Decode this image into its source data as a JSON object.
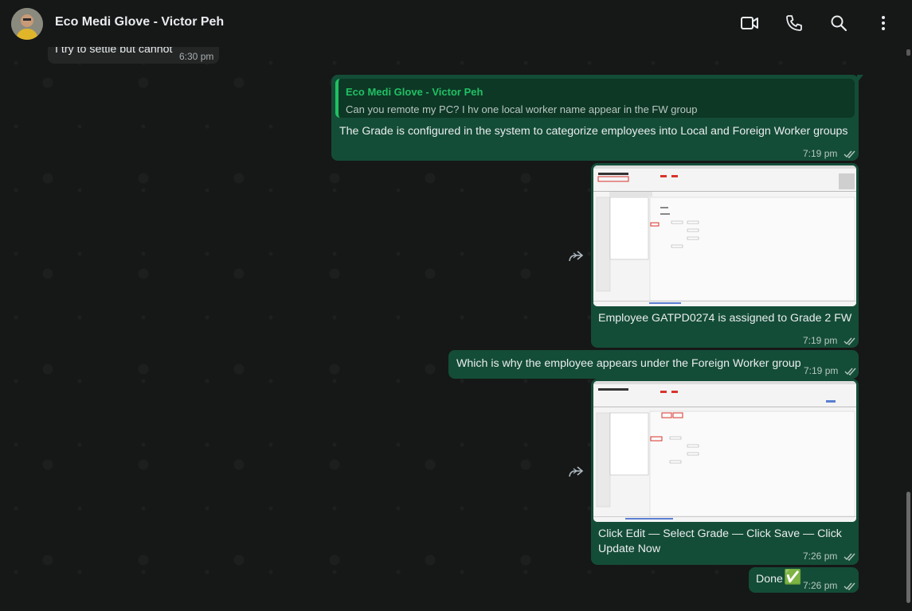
{
  "header": {
    "contact_name": "Eco Medi Glove - Victor Peh",
    "icons": [
      "video-call-icon",
      "voice-call-icon",
      "search-icon",
      "menu-icon"
    ]
  },
  "messages": {
    "m0": {
      "text": "I try to settle but cannot",
      "time": "6:30 pm"
    },
    "m1": {
      "quote_name": "Eco Medi Glove - Victor Peh",
      "quote_text": "Can you remote my PC? I hv one local worker name appear in the FW group",
      "text": "The Grade is configured in the system to categorize employees into Local and Foreign Worker groups",
      "time": "7:19 pm"
    },
    "m2": {
      "caption": "Employee GATPD0274 is assigned to Grade 2 FW",
      "time": "7:19 pm"
    },
    "m3": {
      "text": "Which is why the employee appears under the Foreign Worker group",
      "time": "7:19 pm"
    },
    "m4": {
      "caption_line1": "Click Edit — Select Grade — Click Save — Click",
      "caption_line2": "Update Now",
      "time": "7:26 pm"
    },
    "m5": {
      "text": "Done",
      "emoji": "✅",
      "time": "7:26 pm"
    }
  },
  "colors": {
    "outgoing_bubble": "#144d37",
    "incoming_bubble": "#242626",
    "quote_accent": "#21c063",
    "read_ticks": "#b5c8bf"
  }
}
